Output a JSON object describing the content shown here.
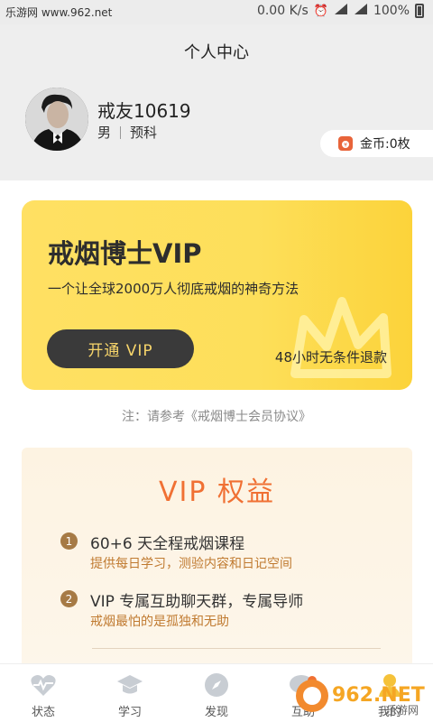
{
  "status_bar": {
    "site": "乐游网 www.962.net",
    "speed": "0.00 K/s",
    "battery": "100%"
  },
  "header": {
    "title": "个人中心",
    "username": "戒友10619",
    "gender": "男",
    "level": "预科",
    "coins": "金币:0枚"
  },
  "vip_card": {
    "title": "戒烟博士VIP",
    "subtitle": "一个让全球2000万人彻底戒烟的神奇方法",
    "button_label": "开通 VIP",
    "refund_text": "48小时无条件退款"
  },
  "agreement_note": "注：请参考《戒烟博士会员协议》",
  "benefits": {
    "title": "VIP 权益",
    "items": [
      {
        "num": "1",
        "title": "60+6 天全程戒烟课程",
        "desc": "提供每日学习，测验内容和日记空间"
      },
      {
        "num": "2",
        "title": "VIP 专属互助聊天群，专属导师",
        "desc": "戒烟最怕的是孤独和无助"
      }
    ]
  },
  "tabs": [
    {
      "label": "状态",
      "icon": "heartbeat-icon"
    },
    {
      "label": "学习",
      "icon": "graduation-cap-icon"
    },
    {
      "label": "发现",
      "icon": "compass-icon"
    },
    {
      "label": "互助",
      "icon": "chat-bubble-icon"
    },
    {
      "label": "我的",
      "icon": "profile-icon"
    }
  ],
  "watermark": {
    "logo_text": "962.NET",
    "logo_sub": "乐游网"
  },
  "colors": {
    "accent_orange": "#f07033",
    "vip_yellow": "#fddf5a",
    "dark_button": "#3a3a3a",
    "benefit_desc": "#c07a30"
  }
}
